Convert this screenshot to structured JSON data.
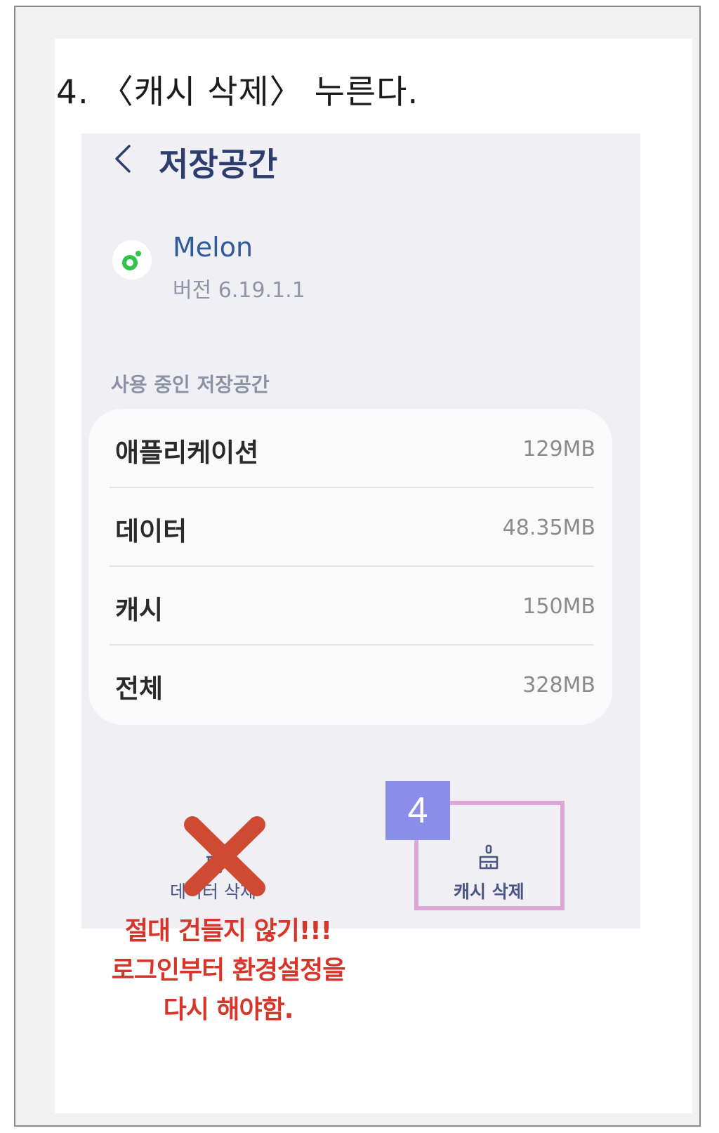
{
  "heading": "4. 〈캐시 삭제〉 누른다.",
  "screen": {
    "title": "저장공간",
    "app": {
      "name": "Melon",
      "version": "버전 6.19.1.1"
    },
    "section_label": "사용 중인 저장공간",
    "rows": [
      {
        "label": "애플리케이션",
        "value": "129MB"
      },
      {
        "label": "데이터",
        "value": "48.35MB"
      },
      {
        "label": "캐시",
        "value": "150MB"
      },
      {
        "label": "전체",
        "value": "328MB"
      }
    ],
    "actions": {
      "clear_data": "데이터 삭제",
      "clear_cache": "캐시 삭제"
    }
  },
  "annotations": {
    "step_number": "4",
    "warning_lines": [
      "절대 건들지 않기!!!",
      "로그인부터 환경설정을",
      "다시 해야함."
    ]
  },
  "colors": {
    "title": "#2d3d6d",
    "warning": "#d7352a",
    "highlight": "#dea8d6",
    "badge": "#8a8ee8",
    "cross": "#cf4a33"
  }
}
